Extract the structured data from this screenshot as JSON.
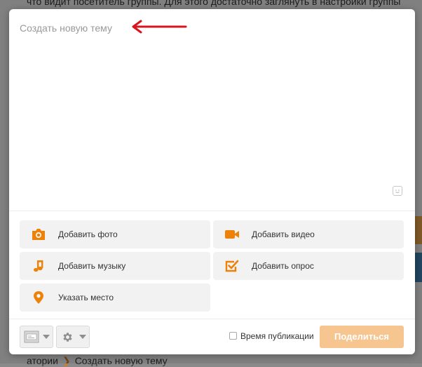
{
  "background": {
    "top_text": "что видит посетитель группы. Для этого достаточно заглянуть в настройки группы",
    "bottom_prefix": "атории",
    "bottom_link": "Создать новую тему"
  },
  "editor": {
    "placeholder": "Создать новую тему"
  },
  "attachments": [
    {
      "label": "Добавить фото",
      "icon": "camera-icon"
    },
    {
      "label": "Добавить видео",
      "icon": "video-camera-icon"
    },
    {
      "label": "Добавить музыку",
      "icon": "music-note-icon"
    },
    {
      "label": "Добавить опрос",
      "icon": "poll-checkbox-icon"
    },
    {
      "label": "Указать место",
      "icon": "map-pin-icon"
    }
  ],
  "footer": {
    "publish_time_label": "Время публикации",
    "publish_time_checked": false,
    "share_label": "Поделиться"
  },
  "colors": {
    "accent": "#ee8208",
    "share_button": "#f7c690",
    "annotation_arrow": "#d8141e"
  }
}
